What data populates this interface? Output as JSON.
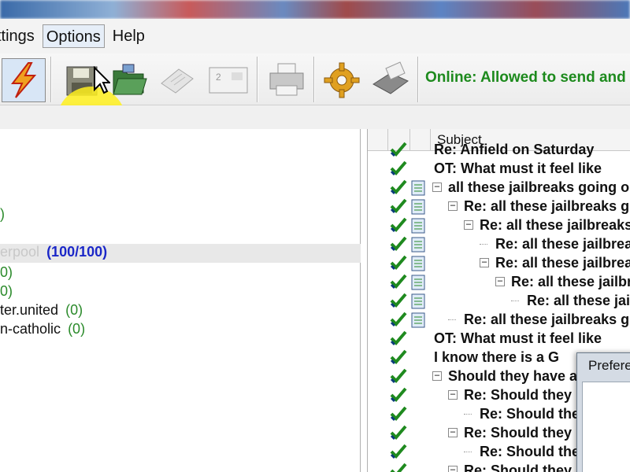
{
  "menu": {
    "settings": "ttings",
    "options": "Options",
    "help": "Help"
  },
  "toolbar": {
    "status": "Online: Allowed to send and",
    "icons": [
      "connect-lightning-icon",
      "save-disk-icon",
      "open-folder-icon",
      "news-paper-icon",
      "card-icon",
      "print-icon",
      "gear-icon",
      "outbox-icon"
    ]
  },
  "groups": {
    "selected_name": "erpool",
    "selected_count": "(100/100)",
    "row_top_count": ")",
    "row_a_count": "0)",
    "row_b_count": "0)",
    "row_c_name": "ter.united",
    "row_c_count": "(0)",
    "row_d_name": "n-catholic",
    "row_d_count": "(0)"
  },
  "threads": {
    "column_subject": "Subject",
    "rows": [
      "Re: Anfield on Saturday",
      "OT: What must it feel like",
      "all these jailbreaks going o",
      "Re: all these jailbreaks g",
      "Re: all these jailbreaks",
      "Re: all these jailbreak",
      "Re: all these jailbrea",
      "Re: all these jailbr",
      "Re: all these jai",
      "Re: all these jailbreaks g",
      "OT: What must it feel like",
      "I know there is a G",
      "Should they have a",
      "Re: Should they",
      "Re: Should the",
      "Re: Should they",
      "Re: Should the",
      "Re: Should they"
    ]
  },
  "dialog": {
    "title": "Prefere"
  },
  "colors": {
    "status_green": "#1d8a1d",
    "count_blue": "#1b27c8",
    "count_green": "#2a8a2a",
    "highlight_yellow": "#fff01e"
  }
}
